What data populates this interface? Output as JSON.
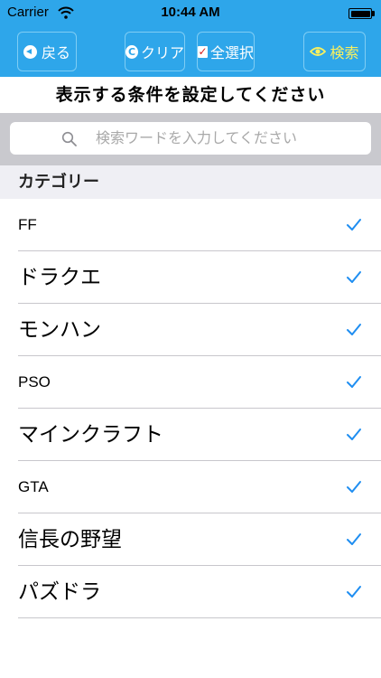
{
  "status_bar": {
    "carrier": "Carrier",
    "time": "10:44 AM"
  },
  "toolbar": {
    "back_label": "戻る",
    "clear_label": "クリア",
    "select_all_label": "全選択",
    "search_label": "検索"
  },
  "title": "表示する条件を設定してください",
  "search": {
    "placeholder": "検索ワードを入力してください"
  },
  "section": {
    "header": "カテゴリー"
  },
  "categories": [
    {
      "label": "FF",
      "checked": true
    },
    {
      "label": "ドラクエ",
      "checked": true
    },
    {
      "label": "モンハン",
      "checked": true
    },
    {
      "label": "PSO",
      "checked": true
    },
    {
      "label": "マインクラフト",
      "checked": true
    },
    {
      "label": "GTA",
      "checked": true
    },
    {
      "label": "信長の野望",
      "checked": true
    },
    {
      "label": "パズドラ",
      "checked": true
    }
  ],
  "colors": {
    "accent": "#2ea6ea",
    "check": "#1f8ef1",
    "search_button_text": "#f8f060"
  }
}
